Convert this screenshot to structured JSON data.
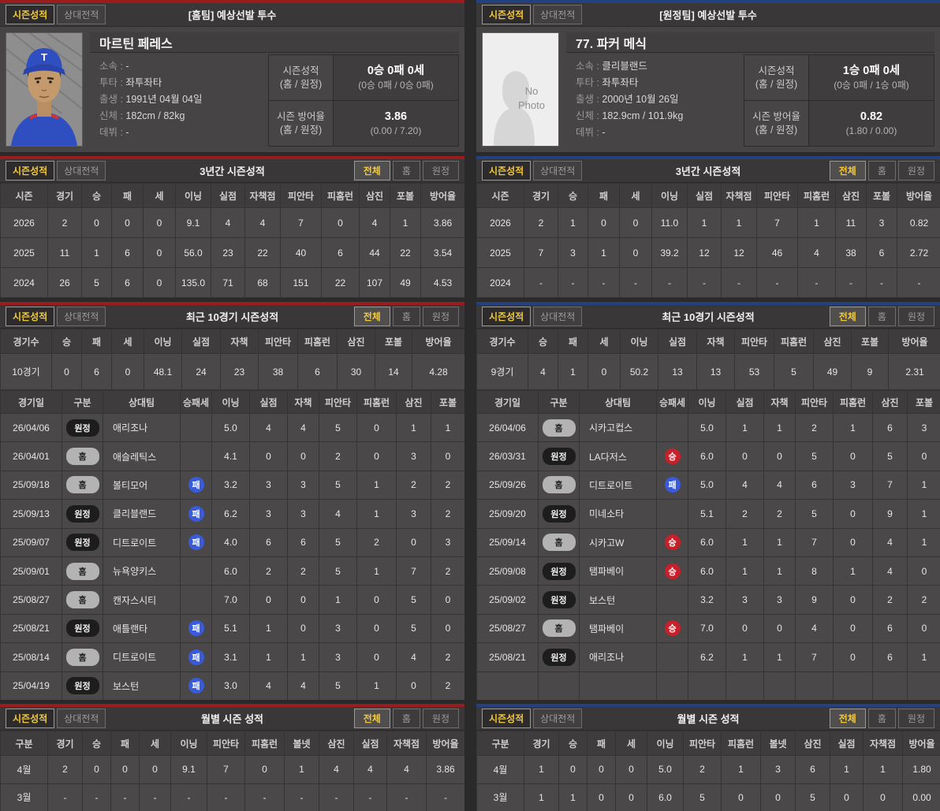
{
  "tabs": {
    "season": "시즌성적",
    "head_to_head": "상대전적"
  },
  "filters": [
    {
      "key": "all",
      "label": "전체"
    },
    {
      "key": "home",
      "label": "홈"
    },
    {
      "key": "away",
      "label": "원정"
    }
  ],
  "colors": {
    "home_accent": "#9a1c1c",
    "away_accent": "#22417e",
    "active_text": "#f2c93c",
    "win_badge": "#c8202a",
    "loss_badge": "#3a5bd9"
  },
  "no_photo_text": [
    "No",
    "Photo"
  ],
  "panels": [
    {
      "side": "left",
      "player": {
        "title": "[홈팀] 예상선발 투수",
        "name": "마르틴 페레스",
        "photo": "player",
        "info": [
          {
            "label": "소속",
            "value": "-"
          },
          {
            "label": "투타",
            "value": "좌투좌타"
          },
          {
            "label": "출생",
            "value": "1991년 04월 04일"
          },
          {
            "label": "신체",
            "value": "182cm / 82kg"
          },
          {
            "label": "데뷔",
            "value": "-"
          }
        ],
        "record": {
          "label": "시즌성적",
          "sublabel": "(홈 / 원정)",
          "value": "0승 0패 0세",
          "subvalue": "(0승 0패 / 0승 0패)"
        },
        "era": {
          "label": "시즌 방어율",
          "sublabel": "(홈 / 원정)",
          "value": "3.86",
          "subvalue": "(0.00 / 7.20)"
        }
      },
      "three_year": {
        "title": "3년간 시즌성적",
        "columns": [
          "시즌",
          "경기",
          "승",
          "패",
          "세",
          "이닝",
          "실점",
          "자책점",
          "피안타",
          "피홈런",
          "삼진",
          "포볼",
          "방어율"
        ],
        "rows": [
          [
            "2026",
            "2",
            "0",
            "0",
            "0",
            "9.1",
            "4",
            "4",
            "7",
            "0",
            "4",
            "1",
            "3.86"
          ],
          [
            "2025",
            "11",
            "1",
            "6",
            "0",
            "56.0",
            "23",
            "22",
            "40",
            "6",
            "44",
            "22",
            "3.54"
          ],
          [
            "2024",
            "26",
            "5",
            "6",
            "0",
            "135.0",
            "71",
            "68",
            "151",
            "22",
            "107",
            "49",
            "4.53"
          ]
        ]
      },
      "recent": {
        "title": "최근 10경기 시즌성적",
        "summary_columns": [
          "경기수",
          "승",
          "패",
          "세",
          "이닝",
          "실점",
          "자책",
          "피안타",
          "피홈런",
          "삼진",
          "포볼",
          "방어율"
        ],
        "summary_row": [
          "10경기",
          "0",
          "6",
          "0",
          "48.1",
          "24",
          "23",
          "38",
          "6",
          "30",
          "14",
          "4.28"
        ],
        "game_columns": [
          "경기일",
          "구분",
          "상대팀",
          "승패세",
          "이닝",
          "실점",
          "자책",
          "피안타",
          "피홈런",
          "삼진",
          "포볼"
        ],
        "games": [
          {
            "date": "26/04/06",
            "loc": "원정",
            "opp": "애리조나",
            "result": "",
            "stats": [
              "5.0",
              "4",
              "4",
              "5",
              "0",
              "1",
              "1"
            ]
          },
          {
            "date": "26/04/01",
            "loc": "홈",
            "opp": "애슬레틱스",
            "result": "",
            "stats": [
              "4.1",
              "0",
              "0",
              "2",
              "0",
              "3",
              "0"
            ]
          },
          {
            "date": "25/09/18",
            "loc": "홈",
            "opp": "볼티모어",
            "result": "패",
            "stats": [
              "3.2",
              "3",
              "3",
              "5",
              "1",
              "2",
              "2"
            ]
          },
          {
            "date": "25/09/13",
            "loc": "원정",
            "opp": "클리블랜드",
            "result": "패",
            "stats": [
              "6.2",
              "3",
              "3",
              "4",
              "1",
              "3",
              "2"
            ]
          },
          {
            "date": "25/09/07",
            "loc": "원정",
            "opp": "디트로이트",
            "result": "패",
            "stats": [
              "4.0",
              "6",
              "6",
              "5",
              "2",
              "0",
              "3"
            ]
          },
          {
            "date": "25/09/01",
            "loc": "홈",
            "opp": "뉴욕양키스",
            "result": "",
            "stats": [
              "6.0",
              "2",
              "2",
              "5",
              "1",
              "7",
              "2"
            ]
          },
          {
            "date": "25/08/27",
            "loc": "홈",
            "opp": "캔자스시티",
            "result": "",
            "stats": [
              "7.0",
              "0",
              "0",
              "1",
              "0",
              "5",
              "0"
            ]
          },
          {
            "date": "25/08/21",
            "loc": "원정",
            "opp": "애틀랜타",
            "result": "패",
            "stats": [
              "5.1",
              "1",
              "0",
              "3",
              "0",
              "5",
              "0"
            ]
          },
          {
            "date": "25/08/14",
            "loc": "홈",
            "opp": "디트로이트",
            "result": "패",
            "stats": [
              "3.1",
              "1",
              "1",
              "3",
              "0",
              "4",
              "2"
            ]
          },
          {
            "date": "25/04/19",
            "loc": "원정",
            "opp": "보스턴",
            "result": "패",
            "stats": [
              "3.0",
              "4",
              "4",
              "5",
              "1",
              "0",
              "2"
            ]
          }
        ]
      },
      "monthly": {
        "title": "월별 시즌 성적",
        "columns": [
          "구분",
          "경기",
          "승",
          "패",
          "세",
          "이닝",
          "피안타",
          "피홈런",
          "볼넷",
          "삼진",
          "실점",
          "자책점",
          "방어율"
        ],
        "rows": [
          [
            "4월",
            "2",
            "0",
            "0",
            "0",
            "9.1",
            "7",
            "0",
            "1",
            "4",
            "4",
            "4",
            "3.86"
          ],
          [
            "3월",
            "-",
            "-",
            "-",
            "-",
            "-",
            "-",
            "-",
            "-",
            "-",
            "-",
            "-",
            "-"
          ]
        ]
      }
    },
    {
      "side": "right",
      "player": {
        "title": "[원정팀] 예상선발 투수",
        "name": "77. 파커 메식",
        "photo": "none",
        "info": [
          {
            "label": "소속",
            "value": "클리블랜드"
          },
          {
            "label": "투타",
            "value": "좌투좌타"
          },
          {
            "label": "출생",
            "value": "2000년 10월 26일"
          },
          {
            "label": "신체",
            "value": "182.9cm / 101.9kg"
          },
          {
            "label": "데뷔",
            "value": "-"
          }
        ],
        "record": {
          "label": "시즌성적",
          "sublabel": "(홈 / 원정)",
          "value": "1승 0패 0세",
          "subvalue": "(0승 0패 / 1승 0패)"
        },
        "era": {
          "label": "시즌 방어율",
          "sublabel": "(홈 / 원정)",
          "value": "0.82",
          "subvalue": "(1.80 / 0.00)"
        }
      },
      "three_year": {
        "title": "3년간 시즌성적",
        "columns": [
          "시즌",
          "경기",
          "승",
          "패",
          "세",
          "이닝",
          "실점",
          "자책점",
          "피안타",
          "피홈런",
          "삼진",
          "포볼",
          "방어율"
        ],
        "rows": [
          [
            "2026",
            "2",
            "1",
            "0",
            "0",
            "11.0",
            "1",
            "1",
            "7",
            "1",
            "11",
            "3",
            "0.82"
          ],
          [
            "2025",
            "7",
            "3",
            "1",
            "0",
            "39.2",
            "12",
            "12",
            "46",
            "4",
            "38",
            "6",
            "2.72"
          ],
          [
            "2024",
            "-",
            "-",
            "-",
            "-",
            "-",
            "-",
            "-",
            "-",
            "-",
            "-",
            "-",
            "-"
          ]
        ]
      },
      "recent": {
        "title": "최근 10경기 시즌성적",
        "summary_columns": [
          "경기수",
          "승",
          "패",
          "세",
          "이닝",
          "실점",
          "자책",
          "피안타",
          "피홈런",
          "삼진",
          "포볼",
          "방어율"
        ],
        "summary_row": [
          "9경기",
          "4",
          "1",
          "0",
          "50.2",
          "13",
          "13",
          "53",
          "5",
          "49",
          "9",
          "2.31"
        ],
        "game_columns": [
          "경기일",
          "구분",
          "상대팀",
          "승패세",
          "이닝",
          "실점",
          "자책",
          "피안타",
          "피홈런",
          "삼진",
          "포볼"
        ],
        "games": [
          {
            "date": "26/04/06",
            "loc": "홈",
            "opp": "시카고컵스",
            "result": "",
            "stats": [
              "5.0",
              "1",
              "1",
              "2",
              "1",
              "6",
              "3"
            ]
          },
          {
            "date": "26/03/31",
            "loc": "원정",
            "opp": "LA다저스",
            "result": "승",
            "stats": [
              "6.0",
              "0",
              "0",
              "5",
              "0",
              "5",
              "0"
            ]
          },
          {
            "date": "25/09/26",
            "loc": "홈",
            "opp": "디트로이트",
            "result": "패",
            "stats": [
              "5.0",
              "4",
              "4",
              "6",
              "3",
              "7",
              "1"
            ]
          },
          {
            "date": "25/09/20",
            "loc": "원정",
            "opp": "미네소타",
            "result": "",
            "stats": [
              "5.1",
              "2",
              "2",
              "5",
              "0",
              "9",
              "1"
            ]
          },
          {
            "date": "25/09/14",
            "loc": "홈",
            "opp": "시카고W",
            "result": "승",
            "stats": [
              "6.0",
              "1",
              "1",
              "7",
              "0",
              "4",
              "1"
            ]
          },
          {
            "date": "25/09/08",
            "loc": "원정",
            "opp": "탬파베이",
            "result": "승",
            "stats": [
              "6.0",
              "1",
              "1",
              "8",
              "1",
              "4",
              "0"
            ]
          },
          {
            "date": "25/09/02",
            "loc": "원정",
            "opp": "보스턴",
            "result": "",
            "stats": [
              "3.2",
              "3",
              "3",
              "9",
              "0",
              "2",
              "2"
            ]
          },
          {
            "date": "25/08/27",
            "loc": "홈",
            "opp": "탬파베이",
            "result": "승",
            "stats": [
              "7.0",
              "0",
              "0",
              "4",
              "0",
              "6",
              "0"
            ]
          },
          {
            "date": "25/08/21",
            "loc": "원정",
            "opp": "애리조나",
            "result": "",
            "stats": [
              "6.2",
              "1",
              "1",
              "7",
              "0",
              "6",
              "1"
            ]
          },
          {
            "date": "",
            "loc": "",
            "opp": "",
            "result": "",
            "stats": [
              "",
              "",
              "",
              "",
              "",
              "",
              ""
            ]
          }
        ]
      },
      "monthly": {
        "title": "월별 시즌 성적",
        "columns": [
          "구분",
          "경기",
          "승",
          "패",
          "세",
          "이닝",
          "피안타",
          "피홈런",
          "볼넷",
          "삼진",
          "실점",
          "자책점",
          "방어율"
        ],
        "rows": [
          [
            "4월",
            "1",
            "0",
            "0",
            "0",
            "5.0",
            "2",
            "1",
            "3",
            "6",
            "1",
            "1",
            "1.80"
          ],
          [
            "3월",
            "1",
            "1",
            "0",
            "0",
            "6.0",
            "5",
            "0",
            "0",
            "5",
            "0",
            "0",
            "0.00"
          ]
        ]
      }
    }
  ]
}
